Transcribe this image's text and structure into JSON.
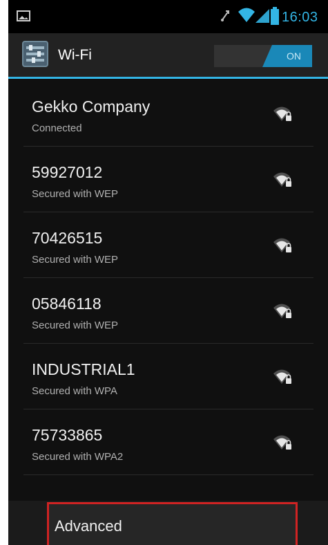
{
  "status_bar": {
    "time": "16:03",
    "icons": [
      "image-notification-icon",
      "rotation-icon",
      "wifi-signal-icon",
      "cell-signal-icon",
      "battery-icon"
    ],
    "accent_color": "#33b5e5"
  },
  "action_bar": {
    "title": "Wi-Fi",
    "toggle_label": "ON",
    "toggle_state": "on"
  },
  "networks": [
    {
      "name": "Gekko Company",
      "status": "Connected"
    },
    {
      "name": "59927012",
      "status": "Secured with WEP"
    },
    {
      "name": "70426515",
      "status": "Secured with WEP"
    },
    {
      "name": "05846118",
      "status": "Secured with WEP"
    },
    {
      "name": "INDUSTRIAL1",
      "status": "Secured with WPA"
    },
    {
      "name": "75733865",
      "status": "Secured with WPA2"
    }
  ],
  "menu": {
    "advanced_label": "Advanced"
  }
}
